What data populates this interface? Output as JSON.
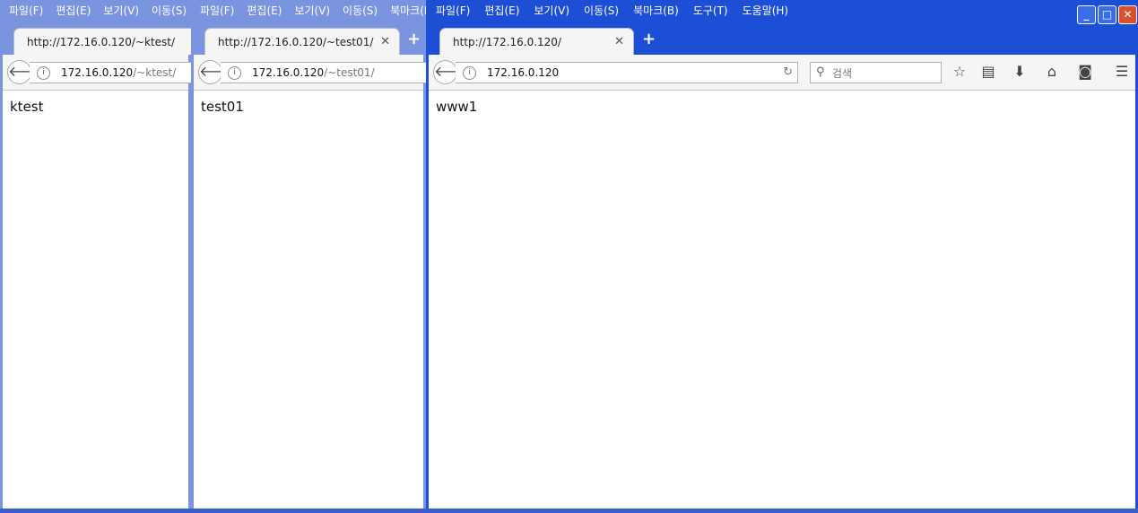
{
  "menu": [
    "파일(F)",
    "편집(E)",
    "보기(V)",
    "이동(S)",
    "북마크(B)",
    "도구(T)",
    "도움말(H)"
  ],
  "windows": [
    {
      "tab_title": "http://172.16.0.120/~ktest/",
      "url_host": "172.16.0.120",
      "url_path": "/~ktest/",
      "content": "ktest"
    },
    {
      "tab_title": "http://172.16.0.120/~test01/",
      "url_host": "172.16.0.120",
      "url_path": "/~test01/",
      "content": "test01"
    },
    {
      "tab_title": "http://172.16.0.120/",
      "url_host": "172.16.0.120",
      "url_path": "",
      "content": "www1",
      "search_placeholder": "검색"
    }
  ],
  "icons": {
    "back": "back-arrow-icon",
    "info": "info-icon",
    "close_tab": "close-icon",
    "new_tab": "plus-icon",
    "reload": "reload-icon",
    "search": "search-icon",
    "bookmark": "star-icon",
    "reading_list": "clipboard-icon",
    "download": "download-icon",
    "home": "home-icon",
    "pocket": "pocket-icon",
    "menu": "hamburger-icon"
  }
}
